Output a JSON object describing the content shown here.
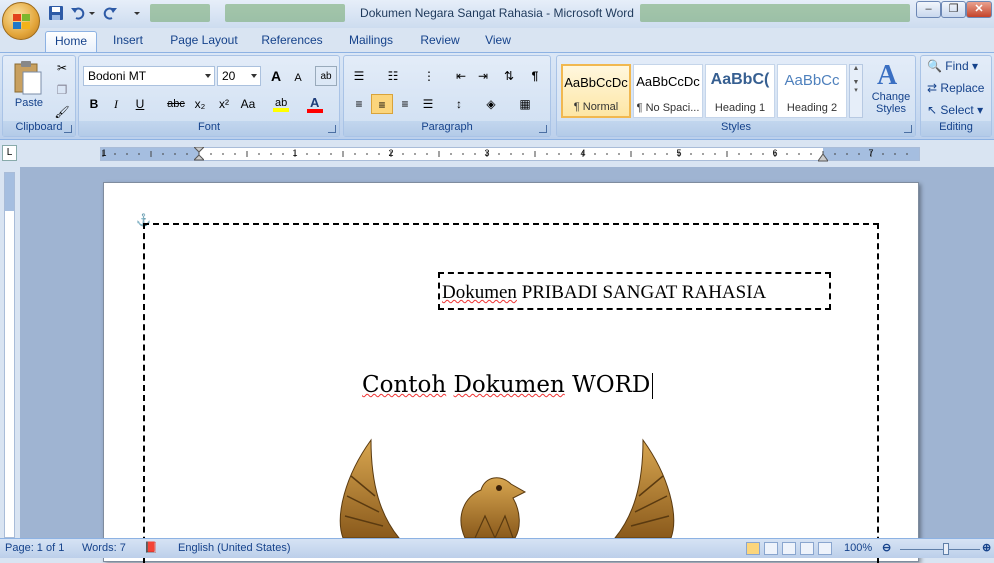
{
  "window": {
    "title": "Dokumen Negara Sangat Rahasia - Microsoft Word",
    "min": "–",
    "max": "❐",
    "close": "✕"
  },
  "tabs": [
    "Home",
    "Insert",
    "Page Layout",
    "References",
    "Mailings",
    "Review",
    "View"
  ],
  "ribbon": {
    "clipboard": {
      "label": "Clipboard",
      "paste": "Paste"
    },
    "font": {
      "label": "Font",
      "family": "Bodoni MT",
      "size": "20",
      "bold": "B",
      "italic": "I",
      "underline": "U",
      "strike": "abc",
      "sub": "x₂",
      "sup": "x²",
      "case": "Aa",
      "grow": "A",
      "shrink": "A"
    },
    "paragraph": {
      "label": "Paragraph",
      "pilcrow": "¶"
    },
    "styles": {
      "label": "Styles",
      "items": [
        {
          "sample": "AaBbCcDc",
          "name": "¶ Normal"
        },
        {
          "sample": "AaBbCcDc",
          "name": "¶ No Spaci..."
        },
        {
          "sample": "AaBbC(",
          "name": "Heading 1"
        },
        {
          "sample": "AaBbCc",
          "name": "Heading 2"
        }
      ],
      "change": "Change Styles"
    },
    "editing": {
      "label": "Editing",
      "find": "Find",
      "replace": "Replace",
      "select": "Select"
    }
  },
  "ruler": {
    "numbers": [
      "1",
      "1",
      "2",
      "3",
      "4",
      "5",
      "6",
      "7"
    ]
  },
  "document": {
    "textbox_word": "Dokumen",
    "textbox_rest": " PRIBADI SANGAT RAHASIA",
    "title_words": [
      "Contoh",
      "Dokumen",
      "WORD"
    ]
  },
  "status": {
    "page": "Page: 1 of 1",
    "words": "Words: 7",
    "language": "English (United States)",
    "zoom": "100%"
  },
  "colors": {
    "accent": "#15428b",
    "highlight": "#ffff00",
    "font_color": "#ff0000"
  }
}
